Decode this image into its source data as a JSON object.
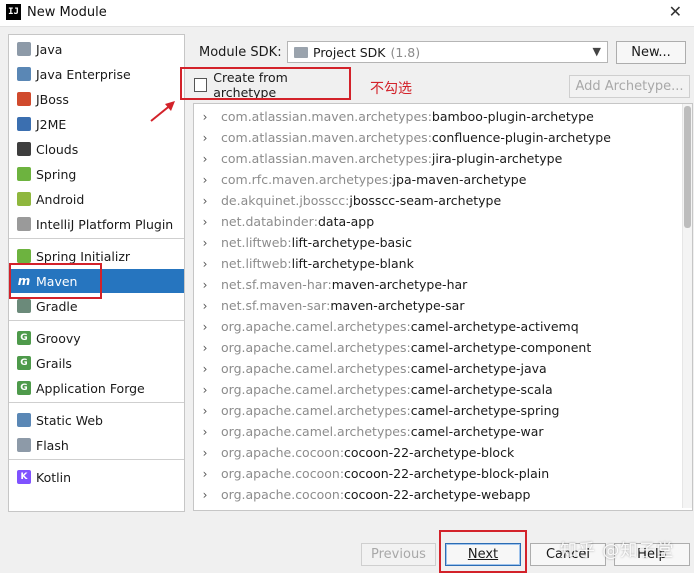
{
  "window": {
    "title": "New Module",
    "icon_text": "IJ",
    "close_symbol": "✕"
  },
  "left_panel": {
    "items": [
      {
        "label": "Java",
        "icon": "folder-icon",
        "color": "#8d9aa8",
        "glyph": ""
      },
      {
        "label": "Java Enterprise",
        "icon": "java-enterprise-icon",
        "color": "#5a87b5",
        "glyph": ""
      },
      {
        "label": "JBoss",
        "icon": "jboss-icon",
        "color": "#d04a2d",
        "glyph": ""
      },
      {
        "label": "J2ME",
        "icon": "j2me-icon",
        "color": "#3b6fb0",
        "glyph": ""
      },
      {
        "label": "Clouds",
        "icon": "cloud-icon",
        "color": "#3e3e3e",
        "glyph": ""
      },
      {
        "label": "Spring",
        "icon": "spring-icon",
        "color": "#6db33f",
        "glyph": ""
      },
      {
        "label": "Android",
        "icon": "android-icon",
        "color": "#8fb73e",
        "glyph": ""
      },
      {
        "label": "IntelliJ Platform Plugin",
        "icon": "plugin-icon",
        "color": "#9a9a9a",
        "glyph": ""
      },
      {
        "label": "Spring Initializr",
        "icon": "spring-initializr-icon",
        "color": "#6db33f",
        "glyph": ""
      },
      {
        "label": "Maven",
        "icon": "maven-icon",
        "color": "#2675bf",
        "glyph": "m"
      },
      {
        "label": "Gradle",
        "icon": "gradle-icon",
        "color": "#6b8a7a",
        "glyph": ""
      },
      {
        "label": "Groovy",
        "icon": "groovy-icon",
        "color": "#4e9a4b",
        "glyph": "G"
      },
      {
        "label": "Grails",
        "icon": "grails-icon",
        "color": "#4e9a4b",
        "glyph": "G"
      },
      {
        "label": "Application Forge",
        "icon": "forge-icon",
        "color": "#4e9a4b",
        "glyph": "G"
      },
      {
        "label": "Static Web",
        "icon": "globe-icon",
        "color": "#5a87b5",
        "glyph": ""
      },
      {
        "label": "Flash",
        "icon": "flash-icon",
        "color": "#8d9aa8",
        "glyph": ""
      },
      {
        "label": "Kotlin",
        "icon": "kotlin-icon",
        "color": "#7f52ff",
        "glyph": "K"
      }
    ],
    "selected_index": 9
  },
  "sdk": {
    "label": "Module SDK:",
    "value": "Project SDK",
    "version": "(1.8)",
    "new_button": "New..."
  },
  "archetype": {
    "checkbox_label": "Create from archetype",
    "checked": false,
    "add_button": "Add Archetype...",
    "annotation": "不勾选"
  },
  "archetypes": [
    {
      "group": "com.atlassian.maven.archetypes",
      "artifact": "bamboo-plugin-archetype"
    },
    {
      "group": "com.atlassian.maven.archetypes",
      "artifact": "confluence-plugin-archetype"
    },
    {
      "group": "com.atlassian.maven.archetypes",
      "artifact": "jira-plugin-archetype"
    },
    {
      "group": "com.rfc.maven.archetypes",
      "artifact": "jpa-maven-archetype"
    },
    {
      "group": "de.akquinet.jbosscc",
      "artifact": "jbosscc-seam-archetype"
    },
    {
      "group": "net.databinder",
      "artifact": "data-app"
    },
    {
      "group": "net.liftweb",
      "artifact": "lift-archetype-basic"
    },
    {
      "group": "net.liftweb",
      "artifact": "lift-archetype-blank"
    },
    {
      "group": "net.sf.maven-har",
      "artifact": "maven-archetype-har"
    },
    {
      "group": "net.sf.maven-sar",
      "artifact": "maven-archetype-sar"
    },
    {
      "group": "org.apache.camel.archetypes",
      "artifact": "camel-archetype-activemq"
    },
    {
      "group": "org.apache.camel.archetypes",
      "artifact": "camel-archetype-component"
    },
    {
      "group": "org.apache.camel.archetypes",
      "artifact": "camel-archetype-java"
    },
    {
      "group": "org.apache.camel.archetypes",
      "artifact": "camel-archetype-scala"
    },
    {
      "group": "org.apache.camel.archetypes",
      "artifact": "camel-archetype-spring"
    },
    {
      "group": "org.apache.camel.archetypes",
      "artifact": "camel-archetype-war"
    },
    {
      "group": "org.apache.cocoon",
      "artifact": "cocoon-22-archetype-block"
    },
    {
      "group": "org.apache.cocoon",
      "artifact": "cocoon-22-archetype-block-plain"
    },
    {
      "group": "org.apache.cocoon",
      "artifact": "cocoon-22-archetype-webapp"
    }
  ],
  "footer": {
    "previous": "Previous",
    "next": "Next",
    "cancel": "Cancel",
    "help": "Help"
  },
  "watermark": "知乎 @知子堂",
  "colors": {
    "selection": "#2675bf",
    "annotation": "#d3222a"
  }
}
